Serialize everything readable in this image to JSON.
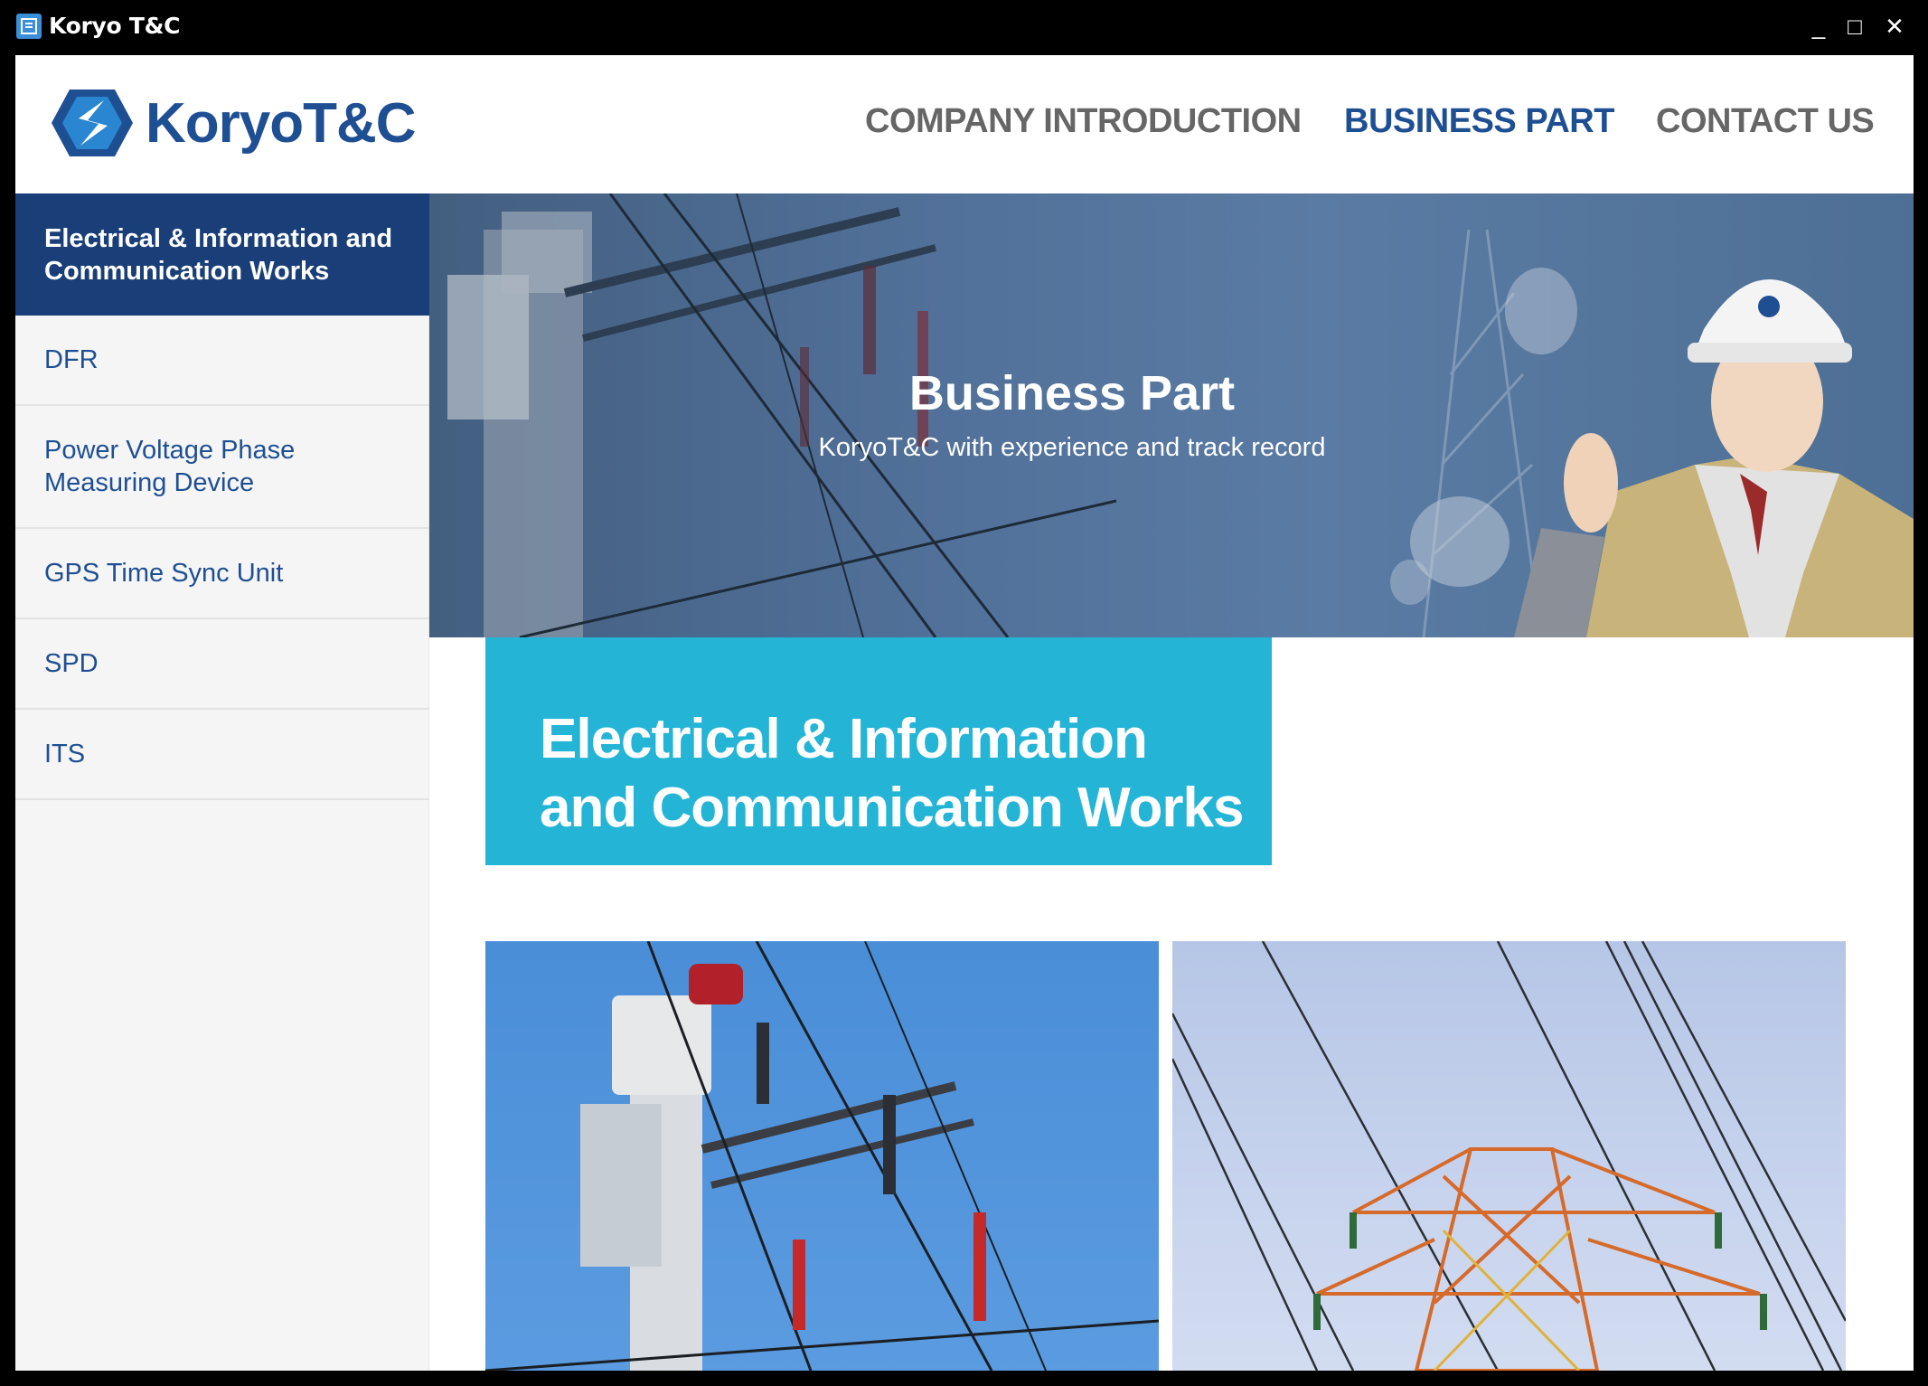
{
  "window": {
    "title": "Koryo T&C",
    "minimize": "_",
    "maximize": "□",
    "close": "✕"
  },
  "header": {
    "logo_text": "KoryoT&C",
    "nav": [
      {
        "label": "COMPANY INTRODUCTION",
        "active": false
      },
      {
        "label": "BUSINESS PART",
        "active": true
      },
      {
        "label": "CONTACT US",
        "active": false
      }
    ]
  },
  "sidebar": {
    "items": [
      {
        "label": "Electrical & Information and Communication Works",
        "active": true
      },
      {
        "label": "DFR",
        "active": false
      },
      {
        "label": "Power Voltage Phase Measuring Device",
        "active": false
      },
      {
        "label": "GPS Time Sync Unit",
        "active": false
      },
      {
        "label": "SPD",
        "active": false
      },
      {
        "label": "ITS",
        "active": false
      }
    ]
  },
  "banner": {
    "title": "Business Part",
    "subtitle": "KoryoT&C with experience and track record"
  },
  "section": {
    "title": "Electrical & Information and Communication Works"
  },
  "colors": {
    "brand_blue": "#1f4f93",
    "sidebar_active": "#1a3f78",
    "accent_cyan": "#24b4d6",
    "nav_inactive": "#666666"
  },
  "icons": [
    "app-icon",
    "logo-mark",
    "minimize-icon",
    "maximize-icon",
    "close-icon"
  ]
}
